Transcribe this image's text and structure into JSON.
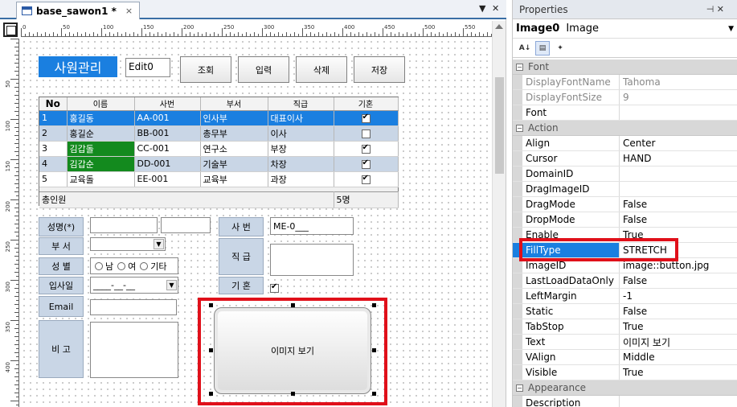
{
  "designer": {
    "tab_title": "base_sawon1 *",
    "tab_close": "×",
    "ruler_marks": [
      "0",
      "50",
      "100",
      "150",
      "200",
      "250",
      "300",
      "350",
      "400",
      "450",
      "500",
      "550"
    ],
    "vruler_marks": [
      "50",
      "100",
      "150",
      "200",
      "250",
      "300",
      "350",
      "400"
    ]
  },
  "form": {
    "title": "사원관리",
    "edit0": "Edit0",
    "buttons": {
      "search": "조회",
      "insert": "입력",
      "delete": "삭제",
      "save": "저장"
    },
    "grid": {
      "headers": [
        "No",
        "이름",
        "사번",
        "부서",
        "직급",
        "기혼"
      ],
      "rows": [
        {
          "no": "1",
          "name": "홍길동",
          "id": "AA-001",
          "dept": "인사부",
          "rank": "대표이사",
          "married": true
        },
        {
          "no": "2",
          "name": "홍길순",
          "id": "BB-001",
          "dept": "총무부",
          "rank": "이사",
          "married": false
        },
        {
          "no": "3",
          "name": "김갑돌",
          "id": "CC-001",
          "dept": "연구소",
          "rank": "부장",
          "married": true
        },
        {
          "no": "4",
          "name": "김갑순",
          "id": "DD-001",
          "dept": "기술부",
          "rank": "차장",
          "married": true
        },
        {
          "no": "5",
          "name": "교육돌",
          "id": "EE-001",
          "dept": "교육부",
          "rank": "과장",
          "married": true
        }
      ],
      "footer_label": "총인원",
      "footer_count": "5명"
    },
    "labels": {
      "name": "성명(*)",
      "dept": "부 서",
      "gender": "성 별",
      "join_date": "입사일",
      "email": "Email",
      "remarks": "비 고",
      "emp_no": "사 번",
      "rank": "직 급",
      "married": "기 혼"
    },
    "gender_options": [
      "남",
      "여",
      "기타"
    ],
    "join_date_mask": "____-__-__",
    "emp_no_value": "ME-0___",
    "image_button_text": "이미지 보기"
  },
  "properties": {
    "title": "Properties",
    "pin": "⊣ ✕",
    "object_name": "Image0",
    "object_type": "Image",
    "categories": {
      "font": "Font",
      "action": "Action",
      "appearance": "Appearance"
    },
    "font_props": [
      {
        "name": "DisplayFontName",
        "value": "Tahoma"
      },
      {
        "name": "DisplayFontSize",
        "value": "9"
      },
      {
        "name": "Font",
        "value": ""
      }
    ],
    "action_props": [
      {
        "name": "Align",
        "value": "Center"
      },
      {
        "name": "Cursor",
        "value": "HAND"
      },
      {
        "name": "DomainID",
        "value": ""
      },
      {
        "name": "DragImageID",
        "value": ""
      },
      {
        "name": "DragMode",
        "value": "False"
      },
      {
        "name": "DropMode",
        "value": "False"
      },
      {
        "name": "Enable",
        "value": "True"
      },
      {
        "name": "FillType",
        "value": "STRETCH"
      },
      {
        "name": "ImageID",
        "value": "image::button.jpg"
      },
      {
        "name": "LastLoadDataOnly",
        "value": "False"
      },
      {
        "name": "LeftMargin",
        "value": "-1"
      },
      {
        "name": "Static",
        "value": "False"
      },
      {
        "name": "TabStop",
        "value": "True"
      },
      {
        "name": "Text",
        "value": "이미지 보기"
      },
      {
        "name": "VAlign",
        "value": "Middle"
      },
      {
        "name": "Visible",
        "value": "True"
      }
    ],
    "appearance_props": [
      {
        "name": "Description",
        "value": ""
      }
    ]
  },
  "colors": {
    "accent": "#1a7fe0",
    "highlight_border": "#e0101a",
    "label_bg": "#c9d6e6",
    "green_cell": "#138a1e"
  }
}
